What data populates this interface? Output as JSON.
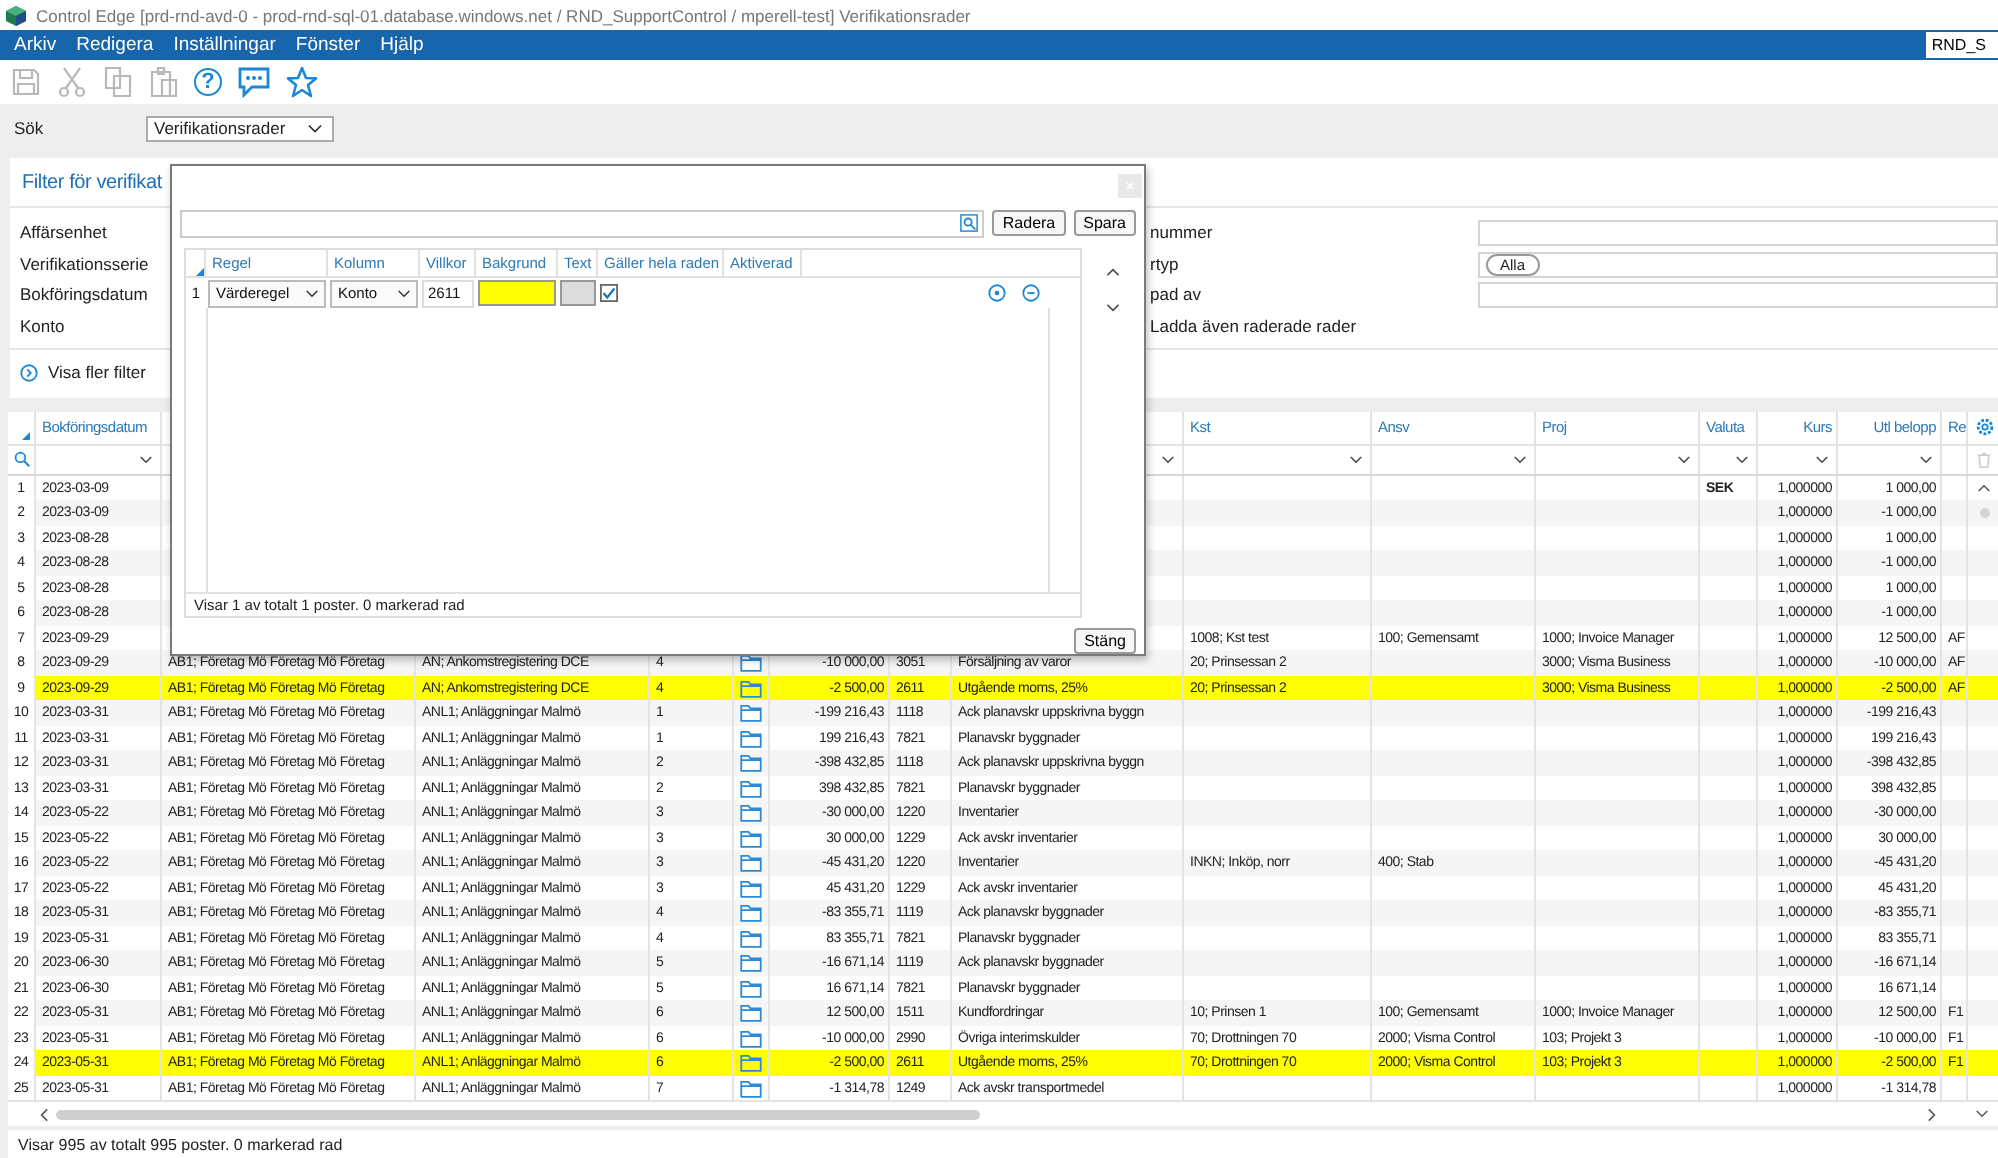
{
  "window": {
    "title": "Control Edge [prd-rnd-avd-0 - prod-rnd-sql-01.database.windows.net / RND_SupportControl / mperell-test] Verifikationsrader"
  },
  "menu": [
    "Arkiv",
    "Redigera",
    "Inställningar",
    "Fönster",
    "Hjälp"
  ],
  "user_box": "RND_S",
  "toolbar": [
    {
      "kind": "save",
      "disabled": true
    },
    {
      "kind": "cut",
      "disabled": true
    },
    {
      "kind": "copy",
      "disabled": true
    },
    {
      "kind": "paste",
      "disabled": true
    },
    {
      "kind": "help",
      "glyph": "?",
      "disabled": false
    },
    {
      "kind": "chat",
      "disabled": false
    },
    {
      "kind": "star",
      "disabled": false
    }
  ],
  "search": {
    "label": "Sök",
    "value": "Verifikationsrader"
  },
  "filter": {
    "title": "Filter för verifikat",
    "left_labels": [
      "Affärsenhet",
      "Verifikationsserie",
      "Bokföringsdatum",
      "Konto"
    ],
    "right": [
      {
        "kind": "field",
        "label": "nummer"
      },
      {
        "kind": "chip",
        "label": "rtyp",
        "chip": "Alla"
      },
      {
        "kind": "field",
        "label": "pad av"
      },
      {
        "kind": "check",
        "label": "Ladda även raderade rader"
      }
    ],
    "more": "Visa fler filter"
  },
  "table": {
    "headings": {
      "date": "Bokföringsdatum",
      "kst": "Kst",
      "ansv": "Ansv",
      "proj": "Proj",
      "currency": "Valuta",
      "rate": "Kurs",
      "foreign_amount": "Utl belopp",
      "re": "Re"
    },
    "rows": [
      {
        "nr": "1",
        "date": "2023-03-09",
        "currency": "SEK",
        "rate": "1,000000",
        "foreign_amount": "1 000,00",
        "highlighted": false
      },
      {
        "nr": "2",
        "date": "2023-03-09",
        "rate": "1,000000",
        "foreign_amount": "-1 000,00",
        "highlighted": false
      },
      {
        "nr": "3",
        "date": "2023-08-28",
        "rate": "1,000000",
        "foreign_amount": "1 000,00",
        "highlighted": false
      },
      {
        "nr": "4",
        "date": "2023-08-28",
        "rate": "1,000000",
        "foreign_amount": "-1 000,00",
        "highlighted": false
      },
      {
        "nr": "5",
        "date": "2023-08-28",
        "rate": "1,000000",
        "foreign_amount": "1 000,00",
        "highlighted": false
      },
      {
        "nr": "6",
        "date": "2023-08-28",
        "rate": "1,000000",
        "foreign_amount": "-1 000,00",
        "highlighted": false
      },
      {
        "nr": "7",
        "date": "2023-09-29",
        "kst": "1008; Kst test",
        "ansv": "100; Gemensamt",
        "proj": "1000; Invoice Manager",
        "rate": "1,000000",
        "foreign_amount": "12 500,00",
        "re": "AF",
        "highlighted": false
      },
      {
        "nr": "8",
        "date": "2023-09-29",
        "company": "AB1; Företag Mö Företag Mö Företag",
        "series": "AN; Ankomstregistering DCE",
        "ver": "4",
        "attachment": true,
        "amount": "-10 000,00",
        "account": "3051",
        "account_name": "Försäljning av varor",
        "kst": "20; Prinsessan 2",
        "proj": "3000; Visma Business",
        "rate": "1,000000",
        "foreign_amount": "-10 000,00",
        "re": "AF",
        "highlighted": false
      },
      {
        "nr": "9",
        "date": "2023-09-29",
        "company": "AB1; Företag Mö Företag Mö Företag",
        "series": "AN; Ankomstregistering DCE",
        "ver": "4",
        "attachment": true,
        "amount": "-2 500,00",
        "account": "2611",
        "account_name": "Utgående moms, 25%",
        "kst": "20; Prinsessan 2",
        "proj": "3000; Visma Business",
        "rate": "1,000000",
        "foreign_amount": "-2 500,00",
        "re": "AF",
        "highlighted": true
      },
      {
        "nr": "10",
        "date": "2023-03-31",
        "company": "AB1; Företag Mö Företag Mö Företag",
        "series": "ANL1; Anläggningar Malmö",
        "ver": "1",
        "attachment": true,
        "amount": "-199 216,43",
        "account": "1118",
        "account_name": "Ack planavskr uppskrivna byggn",
        "rate": "1,000000",
        "foreign_amount": "-199 216,43",
        "highlighted": false
      },
      {
        "nr": "11",
        "date": "2023-03-31",
        "company": "AB1; Företag Mö Företag Mö Företag",
        "series": "ANL1; Anläggningar Malmö",
        "ver": "1",
        "attachment": true,
        "amount": "199 216,43",
        "account": "7821",
        "account_name": "Planavskr byggnader",
        "rate": "1,000000",
        "foreign_amount": "199 216,43",
        "highlighted": false
      },
      {
        "nr": "12",
        "date": "2023-03-31",
        "company": "AB1; Företag Mö Företag Mö Företag",
        "series": "ANL1; Anläggningar Malmö",
        "ver": "2",
        "attachment": true,
        "amount": "-398 432,85",
        "account": "1118",
        "account_name": "Ack planavskr uppskrivna byggn",
        "rate": "1,000000",
        "foreign_amount": "-398 432,85",
        "highlighted": false
      },
      {
        "nr": "13",
        "date": "2023-03-31",
        "company": "AB1; Företag Mö Företag Mö Företag",
        "series": "ANL1; Anläggningar Malmö",
        "ver": "2",
        "attachment": true,
        "amount": "398 432,85",
        "account": "7821",
        "account_name": "Planavskr byggnader",
        "rate": "1,000000",
        "foreign_amount": "398 432,85",
        "highlighted": false
      },
      {
        "nr": "14",
        "date": "2023-05-22",
        "company": "AB1; Företag Mö Företag Mö Företag",
        "series": "ANL1; Anläggningar Malmö",
        "ver": "3",
        "attachment": true,
        "amount": "-30 000,00",
        "account": "1220",
        "account_name": "Inventarier",
        "rate": "1,000000",
        "foreign_amount": "-30 000,00",
        "highlighted": false
      },
      {
        "nr": "15",
        "date": "2023-05-22",
        "company": "AB1; Företag Mö Företag Mö Företag",
        "series": "ANL1; Anläggningar Malmö",
        "ver": "3",
        "attachment": true,
        "amount": "30 000,00",
        "account": "1229",
        "account_name": "Ack avskr inventarier",
        "rate": "1,000000",
        "foreign_amount": "30 000,00",
        "highlighted": false
      },
      {
        "nr": "16",
        "date": "2023-05-22",
        "company": "AB1; Företag Mö Företag Mö Företag",
        "series": "ANL1; Anläggningar Malmö",
        "ver": "3",
        "attachment": true,
        "amount": "-45 431,20",
        "account": "1220",
        "account_name": "Inventarier",
        "kst": "INKN; Inköp, norr",
        "ansv": "400; Stab",
        "rate": "1,000000",
        "foreign_amount": "-45 431,20",
        "highlighted": false
      },
      {
        "nr": "17",
        "date": "2023-05-22",
        "company": "AB1; Företag Mö Företag Mö Företag",
        "series": "ANL1; Anläggningar Malmö",
        "ver": "3",
        "attachment": true,
        "amount": "45 431,20",
        "account": "1229",
        "account_name": "Ack avskr inventarier",
        "rate": "1,000000",
        "foreign_amount": "45 431,20",
        "highlighted": false
      },
      {
        "nr": "18",
        "date": "2023-05-31",
        "company": "AB1; Företag Mö Företag Mö Företag",
        "series": "ANL1; Anläggningar Malmö",
        "ver": "4",
        "attachment": true,
        "amount": "-83 355,71",
        "account": "1119",
        "account_name": "Ack planavskr byggnader",
        "rate": "1,000000",
        "foreign_amount": "-83 355,71",
        "highlighted": false
      },
      {
        "nr": "19",
        "date": "2023-05-31",
        "company": "AB1; Företag Mö Företag Mö Företag",
        "series": "ANL1; Anläggningar Malmö",
        "ver": "4",
        "attachment": true,
        "amount": "83 355,71",
        "account": "7821",
        "account_name": "Planavskr byggnader",
        "rate": "1,000000",
        "foreign_amount": "83 355,71",
        "highlighted": false
      },
      {
        "nr": "20",
        "date": "2023-06-30",
        "company": "AB1; Företag Mö Företag Mö Företag",
        "series": "ANL1; Anläggningar Malmö",
        "ver": "5",
        "attachment": true,
        "amount": "-16 671,14",
        "account": "1119",
        "account_name": "Ack planavskr byggnader",
        "rate": "1,000000",
        "foreign_amount": "-16 671,14",
        "highlighted": false
      },
      {
        "nr": "21",
        "date": "2023-06-30",
        "company": "AB1; Företag Mö Företag Mö Företag",
        "series": "ANL1; Anläggningar Malmö",
        "ver": "5",
        "attachment": true,
        "amount": "16 671,14",
        "account": "7821",
        "account_name": "Planavskr byggnader",
        "rate": "1,000000",
        "foreign_amount": "16 671,14",
        "highlighted": false
      },
      {
        "nr": "22",
        "date": "2023-05-31",
        "company": "AB1; Företag Mö Företag Mö Företag",
        "series": "ANL1; Anläggningar Malmö",
        "ver": "6",
        "attachment": true,
        "amount": "12 500,00",
        "account": "1511",
        "account_name": "Kundfordringar",
        "kst": "10; Prinsen 1",
        "ansv": "100; Gemensamt",
        "proj": "1000; Invoice Manager",
        "rate": "1,000000",
        "foreign_amount": "12 500,00",
        "re": "F1",
        "highlighted": false
      },
      {
        "nr": "23",
        "date": "2023-05-31",
        "company": "AB1; Företag Mö Företag Mö Företag",
        "series": "ANL1; Anläggningar Malmö",
        "ver": "6",
        "attachment": true,
        "amount": "-10 000,00",
        "account": "2990",
        "account_name": "Övriga interimskulder",
        "kst": "70; Drottningen 70",
        "ansv": "2000; Visma Control",
        "proj": "103; Projekt 3",
        "rate": "1,000000",
        "foreign_amount": "-10 000,00",
        "re": "F1",
        "highlighted": false
      },
      {
        "nr": "24",
        "date": "2023-05-31",
        "company": "AB1; Företag Mö Företag Mö Företag",
        "series": "ANL1; Anläggningar Malmö",
        "ver": "6",
        "attachment": true,
        "amount": "-2 500,00",
        "account": "2611",
        "account_name": "Utgående moms, 25%",
        "kst": "70; Drottningen 70",
        "ansv": "2000; Visma Control",
        "proj": "103; Projekt 3",
        "rate": "1,000000",
        "foreign_amount": "-2 500,00",
        "re": "F1",
        "highlighted": true
      },
      {
        "nr": "25",
        "date": "2023-05-31",
        "company": "AB1; Företag Mö Företag Mö Företag",
        "series": "ANL1; Anläggningar Malmö",
        "ver": "7",
        "attachment": true,
        "amount": "-1 314,78",
        "account": "1249",
        "account_name": "Ack avskr transportmedel",
        "rate": "1,000000",
        "foreign_amount": "-1 314,78",
        "highlighted": false
      }
    ],
    "status": "Visar 995 av totalt 995 poster. 0 markerad rad"
  },
  "dialog": {
    "buttons": [
      "Radera",
      "Spara"
    ],
    "columns": [
      "Regel",
      "Kolumn",
      "Villkor",
      "Bakgrund",
      "Text",
      "Gäller hela raden",
      "Aktiverad"
    ],
    "rules": [
      {
        "nr": "1",
        "rule": "Värderegel",
        "column": "Konto",
        "condition": "2611",
        "whole_row": true
      }
    ],
    "status": "Visar 1 av totalt 1 poster. 0 markerad rad",
    "close_button": "Stäng"
  }
}
